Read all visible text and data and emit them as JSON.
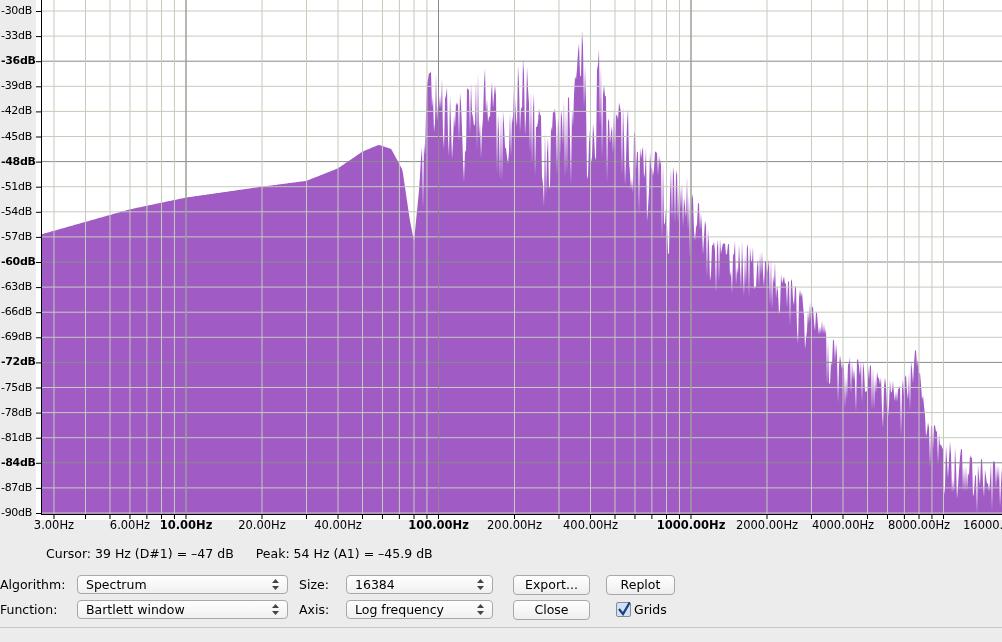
{
  "plot": {
    "y_labels": [
      {
        "text": "-30dB",
        "major": false
      },
      {
        "text": "-33dB",
        "major": false
      },
      {
        "text": "-36dB",
        "major": true
      },
      {
        "text": "-39dB",
        "major": false
      },
      {
        "text": "-42dB",
        "major": false
      },
      {
        "text": "-45dB",
        "major": false
      },
      {
        "text": "-48dB",
        "major": true
      },
      {
        "text": "-51dB",
        "major": false
      },
      {
        "text": "-54dB",
        "major": false
      },
      {
        "text": "-57dB",
        "major": false
      },
      {
        "text": "-60dB",
        "major": true
      },
      {
        "text": "-63dB",
        "major": false
      },
      {
        "text": "-66dB",
        "major": false
      },
      {
        "text": "-69dB",
        "major": false
      },
      {
        "text": "-72dB",
        "major": true
      },
      {
        "text": "-75dB",
        "major": false
      },
      {
        "text": "-78dB",
        "major": false
      },
      {
        "text": "-81dB",
        "major": false
      },
      {
        "text": "-84dB",
        "major": true
      },
      {
        "text": "-87dB",
        "major": false
      },
      {
        "text": "-90dB",
        "major": false
      }
    ],
    "x_labels": [
      {
        "text": "3.00Hz",
        "major": false
      },
      {
        "text": "6.00Hz",
        "major": false
      },
      {
        "text": "10.00Hz",
        "major": true
      },
      {
        "text": "20.00Hz",
        "major": false
      },
      {
        "text": "40.00Hz",
        "major": false
      },
      {
        "text": "100.00Hz",
        "major": true
      },
      {
        "text": "200.00Hz",
        "major": false
      },
      {
        "text": "400.00Hz",
        "major": false
      },
      {
        "text": "1000.00Hz",
        "major": true
      },
      {
        "text": "2000.00Hz",
        "major": false
      },
      {
        "text": "4000.00Hz",
        "major": false
      },
      {
        "text": "8000.00Hz",
        "major": false
      },
      {
        "text": "16000.",
        "major": false
      }
    ]
  },
  "cursor_readout": "Cursor: 39 Hz (D#1) = –47 dB",
  "peak_readout": "Peak: 54 Hz (A1) = –45.9 dB",
  "controls": {
    "algorithm": {
      "label": "Algorithm:",
      "value": "Spectrum"
    },
    "size": {
      "label": "Size:",
      "value": "16384"
    },
    "function": {
      "label": "Function:",
      "value": "Bartlett window"
    },
    "axis": {
      "label": "Axis:",
      "value": "Log frequency"
    },
    "buttons": [
      "Export...",
      "Replot",
      "Close"
    ],
    "grids": {
      "label": "Grids",
      "checked": true
    }
  }
}
